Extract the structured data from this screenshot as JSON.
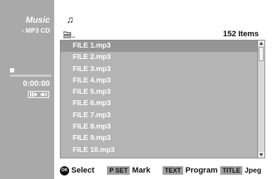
{
  "left_panel": {
    "title": "Music",
    "subtitle": "- MP3 CD",
    "elapsed_time": "0:00:00",
    "progress_fraction": 0.0
  },
  "header": {
    "music_icon": "music-note-icon",
    "folder_icon": "folder-up-icon",
    "folder_label": "..",
    "item_count": "152 Items"
  },
  "file_list": {
    "selected_index": 0,
    "items": [
      "FILE 1.mp3",
      "FILE 2.mp3",
      "FILE 3.mp3",
      "FILE 4.mp3",
      "FILE 5.mp3",
      "FILE 6.mp3",
      "FILE 7.mp3",
      "FILE 8.mp3",
      "FILE 9.mp3",
      "FILE 10.mp3"
    ]
  },
  "help_bar": {
    "ok_key": "OK",
    "select_label": "Select",
    "set_key": "P SET",
    "mark_label": "Mark",
    "text_key": "TEXT",
    "program_label": "Program",
    "title_key": "TITLE",
    "jpeg_label": "Jpeg"
  },
  "colors": {
    "panel_gray": "#a9a9a9",
    "list_gray": "#b4b4b4",
    "selected_row": "#959595",
    "text_white": "#ffffff"
  }
}
